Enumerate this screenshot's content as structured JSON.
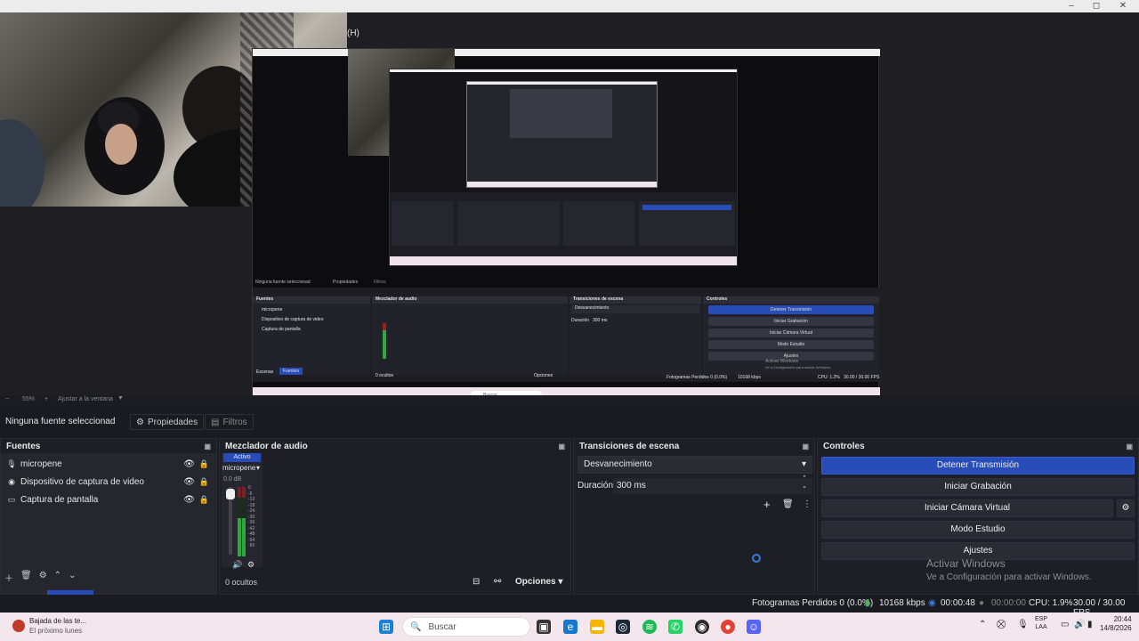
{
  "window": {
    "menu_hint": "(H)",
    "minimize": "–",
    "maximize": "◻",
    "close": "✕"
  },
  "zoom": {
    "level": "55%",
    "fit_label": "Ajustar a la ventana"
  },
  "source_bar": {
    "selected": "Ninguna fuente seleccionad",
    "properties": "Propiedades",
    "filters": "Filtros"
  },
  "sources": {
    "title": "Fuentes",
    "items": [
      {
        "icon": "microphone-icon",
        "glyph": "🎙",
        "label": "micropene"
      },
      {
        "icon": "camera-icon",
        "glyph": "◉",
        "label": "Dispositivo de captura de video"
      },
      {
        "icon": "monitor-icon",
        "glyph": "▭",
        "label": "Captura de pantalla"
      }
    ],
    "tabs": [
      "Escenas",
      "Fuentes"
    ],
    "active_tab": "Fuentes"
  },
  "mixer": {
    "title": "Mezclador de audio",
    "active_label": "Activo",
    "channel": "micropene",
    "db": "0.0 dB",
    "ticks": [
      "0",
      "-6",
      "-12",
      "-18",
      "-24",
      "-30",
      "-36",
      "-42",
      "-48",
      "-54",
      "-60"
    ],
    "hidden_count": "0 ocultos",
    "options": "Opciones",
    "level": 0.55
  },
  "transitions": {
    "title": "Transiciones de escena",
    "selected": "Desvanecimiento",
    "duration_label": "Duración",
    "duration_value": "300 ms"
  },
  "controls": {
    "title": "Controles",
    "buttons": [
      "Detener Transmisión",
      "Iniciar Grabación",
      "Iniciar Cámara Virtual",
      "Modo Estudio",
      "Ajustes"
    ]
  },
  "watermark": {
    "line1": "Activar Windows",
    "line2": "Ve a Configuración para activar Windows."
  },
  "status": {
    "dropped": "Fotogramas Perdidos 0 (0.0%)",
    "bitrate": "10168 kbps",
    "stream_time": "00:00:48",
    "rec_time": "00:00:00",
    "cpu": "CPU: 1.9%",
    "fps": "30.00 / 30.00 FPS"
  },
  "taskbar": {
    "news_title": "Bajada de las te...",
    "news_sub": "El próximo lunes",
    "search_placeholder": "Buscar",
    "lang": "ESP",
    "layout": "LAA",
    "time": "20:44",
    "date": "14/8/2026"
  },
  "capture_mini": {
    "no_source": "Ninguna fuente seleccionad",
    "props": "Propiedades",
    "filters": "Filtros",
    "sources": "Fuentes",
    "mixer": "Mezclador de audio",
    "transitions": "Transiciones de escena",
    "controls": "Controles",
    "btns": [
      "Detener Transmisión",
      "Iniciar Grabación",
      "Iniciar Cámara Virtual",
      "Modo Estudio",
      "Ajustes"
    ],
    "src_items": [
      "micropene",
      "Dispositivo de captura de video",
      "Captura de pantalla"
    ],
    "fade": "Desvanecimiento",
    "dur": "Duración",
    "dur_val": "300 ms",
    "hidden": "0 ocultos",
    "opts": "Opciones",
    "tabs": [
      "Escenas",
      "Fuentes"
    ],
    "status": "Fotogramas Perdidos 0 (0.0%)",
    "kbps": "10168 kbps",
    "cpu": "CPU: 1.2%",
    "fps": "30.00 / 30.00 FPS",
    "wm1": "Activar Windows",
    "wm2": "Ve a Configuración para activar Windows.",
    "search": "Buscar"
  }
}
